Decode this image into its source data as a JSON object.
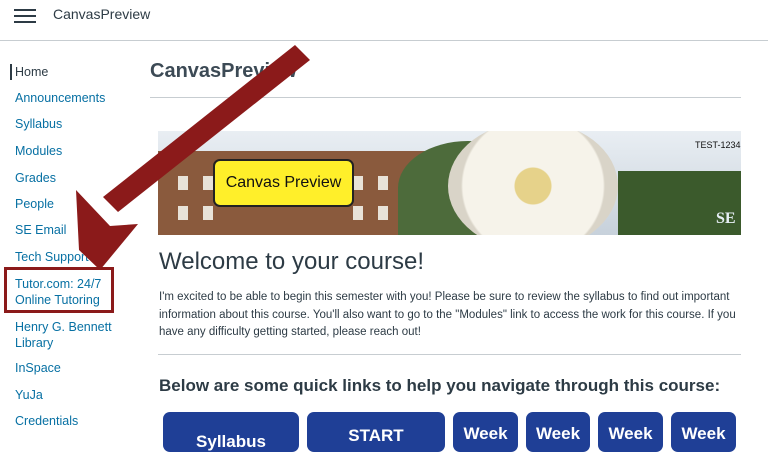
{
  "header": {
    "breadcrumb": "CanvasPreview"
  },
  "nav": {
    "items": [
      {
        "label": "Home"
      },
      {
        "label": "Announcements"
      },
      {
        "label": "Syllabus"
      },
      {
        "label": "Modules"
      },
      {
        "label": "Grades"
      },
      {
        "label": "People"
      },
      {
        "label": "SE Email"
      },
      {
        "label": "Tech Support"
      },
      {
        "label": "Tutor.com: 24/7 Online Tutoring"
      },
      {
        "label": "Henry G. Bennett Library"
      },
      {
        "label": "InSpace"
      },
      {
        "label": "YuJa"
      },
      {
        "label": "Credentials"
      }
    ]
  },
  "main": {
    "page_title": "CanvasPreview",
    "banner_badge": "Canvas Preview",
    "banner_code": "TEST-1234",
    "banner_logo": "SE",
    "welcome": "Welcome to your course!",
    "intro": "I'm excited to be able to begin this semester with you! Please be sure to review the syllabus to find out important information about this course. You'll also want to go to the \"Modules\" link to access the work for this course. If you have any difficulty getting started, please reach out!",
    "subheading": "Below are some quick links to help you navigate through this course:",
    "quick_links": [
      "Syllabus",
      "START",
      "Week",
      "Week",
      "Week",
      "Week"
    ]
  },
  "colors": {
    "link": "#0770a3",
    "quick_link_bg": "#1f3f96",
    "arrow": "#8b1a1a",
    "badge_bg": "#ffef2a"
  }
}
